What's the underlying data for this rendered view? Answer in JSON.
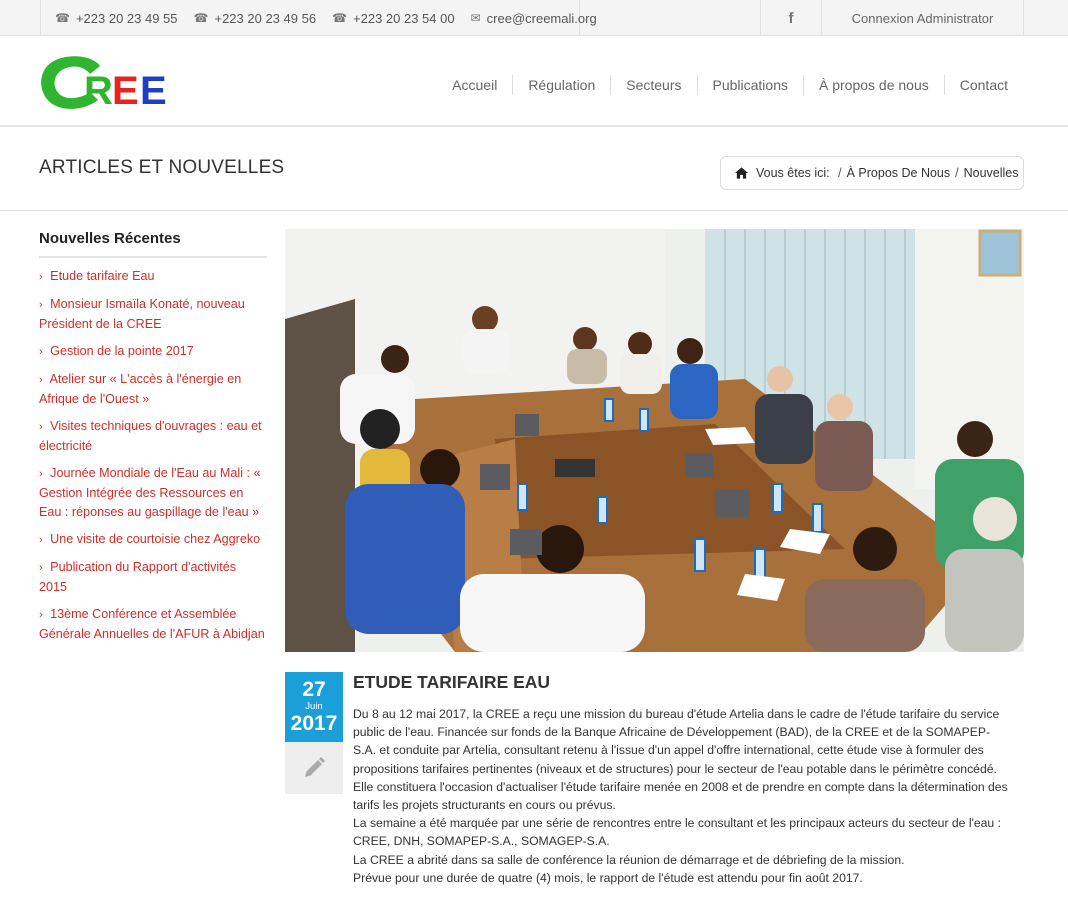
{
  "topbar": {
    "phones": [
      "+223 20 23 49 55",
      "+223 20 23 49 56",
      "+223 20 23 54 00"
    ],
    "email": "cree@creemali.org",
    "facebook_glyph": "f",
    "admin_label": "Connexion Administrator"
  },
  "logo": {
    "text": "CREE",
    "colors": {
      "green": "#2fb52f",
      "red": "#e8231f",
      "blue": "#1c3fc4"
    }
  },
  "nav": {
    "items": [
      "Accueil",
      "Régulation",
      "Secteurs",
      "Publications",
      "À propos de nous",
      "Contact"
    ]
  },
  "page": {
    "title": "ARTICLES ET NOUVELLES",
    "breadcrumb": {
      "prefix": "Vous êtes ici:",
      "items": [
        "À Propos De Nous",
        "Nouvelles"
      ]
    }
  },
  "sidebar": {
    "title": "Nouvelles Récentes",
    "items": [
      "Etude tarifaire Eau",
      "Monsieur Ismaïla Konaté, nouveau Président de la CREE",
      "Gestion de la pointe 2017",
      "Atelier sur « L'accès à l'énergie en Afrique de l'Ouest »",
      "Visites techniques d'ouvrages : eau et électricité",
      "Journée Mondiale de l'Eau au Mali : « Gestion Intégrée des Ressources en Eau : réponses au gaspillage de l'eau »",
      "Une visite de courtoisie chez Aggreko",
      "Publication du Rapport d'activités 2015",
      "13ème Conférence et Assemblée Générale Annuelles de l'AFUR à Abidjan"
    ]
  },
  "post": {
    "day": "27",
    "month": "Juin",
    "year": "2017",
    "title": "ETUDE TARIFAIRE EAU",
    "paragraphs": [
      "Du 8 au 12 mai 2017, la CREE a reçu une mission du bureau d'étude Artelia dans le cadre de l'étude tarifaire du service public de l'eau. Financée sur fonds de la Banque Africaine de Développement (BAD), de la CREE et de la SOMAPEP-S.A. et conduite par Artelia, consultant retenu à l'issue d'un appel d'offre international, cette étude vise à formuler des propositions tarifaires pertinentes (niveaux et de structures) pour le secteur de l'eau potable dans le périmètre concédé. Elle constituera l'occasion d'actualiser l'étude tarifaire menée en 2008 et de prendre en compte dans la détermination des tarifs les projets structurants en cours ou prévus.",
      "La semaine a été marquée par une série de rencontres entre le consultant et les principaux acteurs du secteur de l'eau : CREE, DNH, SOMAPEP-S.A., SOMAGEP-S.A.",
      "La CREE a abrité dans sa salle de conférence la réunion de démarrage et de débriefing de la mission.",
      "Prévue pour une durée de quatre (4) mois, le rapport de l'étude est attendu pour fin août 2017."
    ]
  },
  "colors": {
    "accent_red": "#c9302c",
    "date_blue": "#1b9fd8"
  }
}
